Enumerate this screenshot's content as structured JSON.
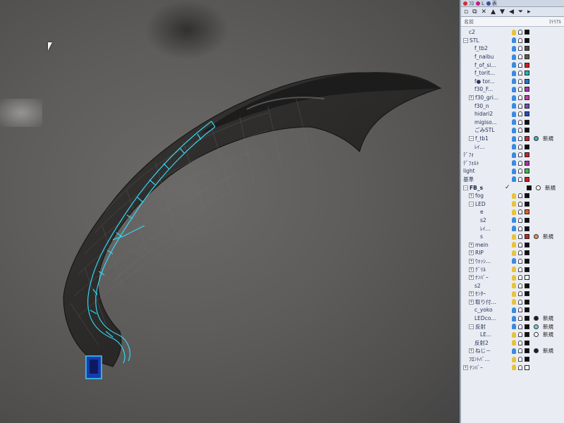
{
  "panel": {
    "tabs": [
      "ﾌﾛ",
      "L",
      "表"
    ],
    "header": {
      "name_col": "名前",
      "material_col": "ﾏﾃﾘｱﾙ"
    },
    "toolbar_icons": [
      "new-layer-icon",
      "copy-icon",
      "delete-icon",
      "up-icon",
      "down-icon",
      "left-icon",
      "filter-icon",
      "more-icon"
    ],
    "rows": [
      {
        "name": "c2",
        "indent": 1,
        "exp": "",
        "bulb": "#e8c23a",
        "color": "#111111"
      },
      {
        "name": "STL",
        "indent": 0,
        "exp": "⊟",
        "bulb": "#3a8ae0",
        "color": "#111111"
      },
      {
        "name": "f_tb2",
        "indent": 2,
        "exp": "",
        "bulb": "#3a8ae0",
        "color": "#4a4a4a"
      },
      {
        "name": "f_naibu",
        "indent": 2,
        "exp": "",
        "bulb": "#3a8ae0",
        "color": "#6a5a3a"
      },
      {
        "name": "f_of_si...",
        "indent": 2,
        "exp": "",
        "bulb": "#3a8ae0",
        "color": "#d02020"
      },
      {
        "name": "f_torit...",
        "indent": 2,
        "exp": "",
        "bulb": "#3a8ae0",
        "color": "#20b8b8"
      },
      {
        "name": "f● tor...",
        "indent": 2,
        "exp": "",
        "bulb": "#3a8ae0",
        "color": "#3070d0"
      },
      {
        "name": "f30_F...",
        "indent": 2,
        "exp": "",
        "bulb": "#3a8ae0",
        "color": "#b030b0"
      },
      {
        "name": "f30_gri...",
        "indent": 1,
        "exp": "⊞",
        "bulb": "#3a8ae0",
        "color": "#c040a0"
      },
      {
        "name": "f30_n",
        "indent": 2,
        "exp": "",
        "bulb": "#3a8ae0",
        "color": "#7050c0"
      },
      {
        "name": "hidari2",
        "indent": 2,
        "exp": "",
        "bulb": "#3a8ae0",
        "color": "#2050c0"
      },
      {
        "name": "migiso...",
        "indent": 2,
        "exp": "",
        "bulb": "#3a8ae0",
        "color": "#111111"
      },
      {
        "name": "ごみSTL",
        "indent": 2,
        "exp": "",
        "bulb": "#3a8ae0",
        "color": "#111111"
      },
      {
        "name": "f_tb1",
        "indent": 1,
        "exp": "⊟",
        "bulb": "#3a8ae0",
        "color": "#d02020",
        "circle": "#40b0d0",
        "label": "新規"
      },
      {
        "name": "ﾚｲ...",
        "indent": 2,
        "exp": "",
        "bulb": "#3a8ae0",
        "color": "#111111"
      },
      {
        "name": "ﾃﾞﾌｫ",
        "indent": 0,
        "exp": "",
        "bulb": "#3a8ae0",
        "color": "#d02020"
      },
      {
        "name": "ﾃﾞﾌｫﾙﾄ",
        "indent": 0,
        "exp": "",
        "bulb": "#3a8ae0",
        "color": "#b030b0"
      },
      {
        "name": "light",
        "indent": 0,
        "exp": "",
        "bulb": "#3a8ae0",
        "color": "#40c040"
      },
      {
        "name": "基準",
        "indent": 0,
        "exp": "",
        "bulb": "#3a8ae0",
        "color": "#d02020"
      },
      {
        "name": "FB_s",
        "indent": 0,
        "exp": "⊟",
        "group": true,
        "check": "✓",
        "color": "#111111",
        "circle": "#ffffff",
        "label": "新規"
      },
      {
        "name": "fog",
        "indent": 1,
        "exp": "⊞",
        "bulb": "#e8c23a",
        "color": "#111111"
      },
      {
        "name": "LED",
        "indent": 1,
        "exp": "⊟",
        "bulb": "#e8c23a",
        "color": "#111111"
      },
      {
        "name": "e",
        "indent": 3,
        "exp": "",
        "bulb": "#e8c23a",
        "color": "#e06020"
      },
      {
        "name": "s2",
        "indent": 3,
        "exp": "",
        "bulb": "#3a8ae0",
        "color": "#111111"
      },
      {
        "name": "ﾚｲ...",
        "indent": 3,
        "exp": "",
        "bulb": "#3a8ae0",
        "color": "#111111"
      },
      {
        "name": "s",
        "indent": 3,
        "exp": "",
        "bulb": "#e8c23a",
        "color": "#d02020",
        "circle": "#e09050",
        "label": "新規"
      },
      {
        "name": "mein",
        "indent": 1,
        "exp": "⊞",
        "bulb": "#e8c23a",
        "color": "#111111"
      },
      {
        "name": "RIP",
        "indent": 1,
        "exp": "⊞",
        "bulb": "#e8c23a",
        "color": "#111111"
      },
      {
        "name": "ｳｫｯｼ...",
        "indent": 1,
        "exp": "⊞",
        "bulb": "#3a8ae0",
        "color": "#111111"
      },
      {
        "name": "ｸﾞﾘﾙ",
        "indent": 1,
        "exp": "⊞",
        "bulb": "#e8c23a",
        "color": "#111111"
      },
      {
        "name": "ﾅﾝﾊﾞｰ",
        "indent": 1,
        "exp": "⊞",
        "bulb": "#e8c23a",
        "color": "#ffffff"
      },
      {
        "name": "s2",
        "indent": 2,
        "exp": "",
        "bulb": "#e8c23a",
        "color": "#111111"
      },
      {
        "name": "ｾﾝﾀｰ",
        "indent": 1,
        "exp": "⊞",
        "bulb": "#e8c23a",
        "color": "#111111"
      },
      {
        "name": "取り付...",
        "indent": 1,
        "exp": "⊞",
        "bulb": "#e8c23a",
        "color": "#111111"
      },
      {
        "name": "c_yoko",
        "indent": 2,
        "exp": "",
        "bulb": "#3a8ae0",
        "color": "#111111"
      },
      {
        "name": "LEDco...",
        "indent": 2,
        "exp": "",
        "bulb": "#3a8ae0",
        "color": "#111111",
        "circle": "#1a2030",
        "label": "新規"
      },
      {
        "name": "反射",
        "indent": 1,
        "exp": "⊟",
        "bulb": "#3a8ae0",
        "color": "#111111",
        "circle": "#70d0d0",
        "label": "新規"
      },
      {
        "name": "LE...",
        "indent": 3,
        "exp": "",
        "bulb": "#e8c23a",
        "color": "#111111",
        "circle": "#ffffff",
        "label": "新規"
      },
      {
        "name": "反射2",
        "indent": 2,
        "exp": "",
        "bulb": "#e8c23a",
        "color": "#111111"
      },
      {
        "name": "ねじ－",
        "indent": 1,
        "exp": "⊞",
        "bulb": "#3a8ae0",
        "color": "#111111",
        "circle": "#1a2030",
        "label": "新規"
      },
      {
        "name": "ﾌﾛﾝﾄﾊﾞ...",
        "indent": 1,
        "exp": "",
        "bulb": "#e8c23a",
        "color": "#111111"
      },
      {
        "name": "ﾅﾝﾊﾞｰ",
        "indent": 0,
        "exp": "⊞",
        "bulb": "#e8c23a",
        "color": "#ffffff"
      }
    ]
  }
}
